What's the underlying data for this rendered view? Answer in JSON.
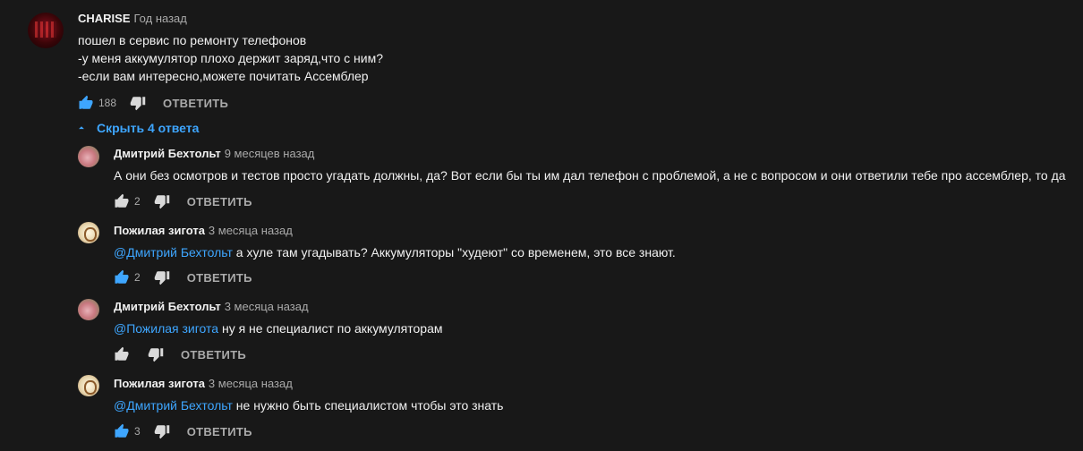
{
  "comments": [
    {
      "author": "CHARISE",
      "time": "Год назад",
      "lines": [
        "пошел в сервис по ремонту телефонов",
        "-у меня аккумулятор плохо держит заряд,что с ним?",
        "-если вам интересно,можете почитать Ассемблер"
      ],
      "likes": "188",
      "reply_label": "ОТВЕТИТЬ"
    }
  ],
  "replies_toggle": "Скрыть 4 ответа",
  "replies": [
    {
      "author": "Дмитрий Бехтольт",
      "time": "9 месяцев назад",
      "text": "А они без осмотров и тестов просто угадать должны, да? Вот если бы ты им дал телефон с проблемой, а не с вопросом и они ответили тебе про ассемблер, то да",
      "likes": "2",
      "reply_label": "ОТВЕТИТЬ"
    },
    {
      "author": "Пожилая зигота",
      "time": "3 месяца назад",
      "mention": "@Дмитрий Бехтольт",
      "text": " а хуле там угадывать? Аккумуляторы \"худеют\" со временем, это все знают.",
      "likes": "2",
      "reply_label": "ОТВЕТИТЬ"
    },
    {
      "author": "Дмитрий Бехтольт",
      "time": "3 месяца назад",
      "mention": "@Пожилая зигота",
      "text": " ну я не специалист по аккумуляторам",
      "likes": "",
      "reply_label": "ОТВЕТИТЬ"
    },
    {
      "author": "Пожилая зигота",
      "time": "3 месяца назад",
      "mention": "@Дмитрий Бехтольт",
      "text": " не нужно быть специалистом чтобы это знать",
      "likes": "3",
      "reply_label": "ОТВЕТИТЬ"
    }
  ],
  "colors": {
    "background": "#181818",
    "link": "#3ea6ff",
    "text": "#f1f1f1",
    "muted": "#aaaaaa"
  }
}
